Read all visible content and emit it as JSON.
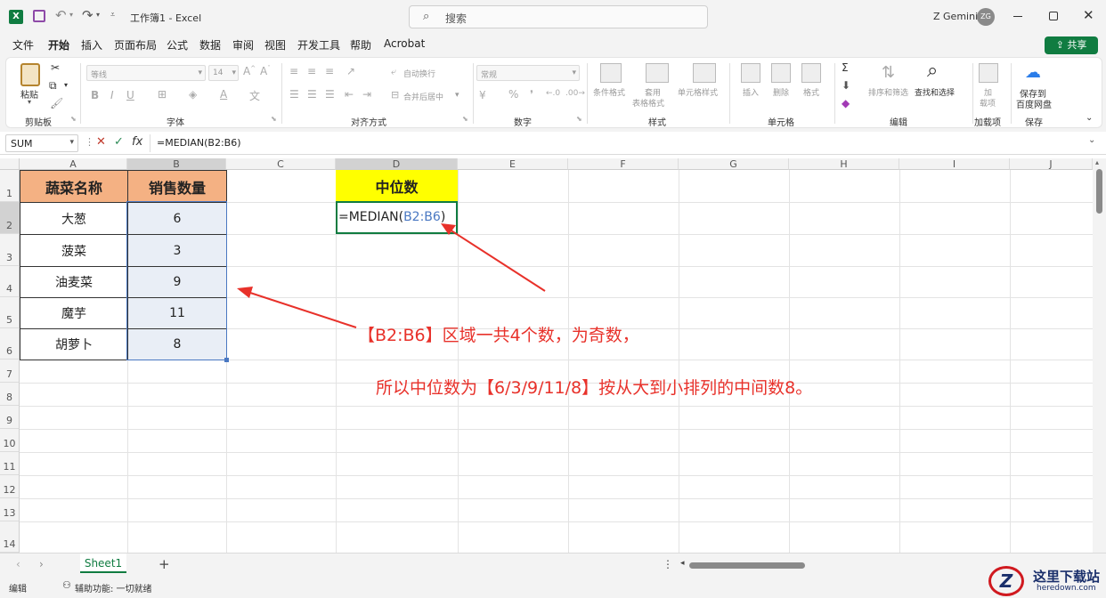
{
  "titlebar": {
    "autosave_icon": "excel-logo",
    "doc_title": "工作簿1",
    "separator": "-",
    "app_name": "Excel",
    "search_placeholder": "搜索",
    "user_name": "Z Gemini",
    "user_initials": "ZG"
  },
  "tabs": [
    "文件",
    "开始",
    "插入",
    "页面布局",
    "公式",
    "数据",
    "审阅",
    "视图",
    "开发工具",
    "帮助",
    "Acrobat"
  ],
  "share_label": "共享",
  "ribbon": {
    "paste": "粘贴",
    "font_name": "等线",
    "font_size": "14",
    "wrap_text": "自动换行",
    "merge_center": "合并后居中",
    "number_format": "常规",
    "cond_format": "条件格式",
    "table_format_1": "套用",
    "table_format_2": "表格格式",
    "cell_style": "单元格样式",
    "insert": "插入",
    "delete": "删除",
    "format": "格式",
    "sort_filter": "排序和筛选",
    "find_select": "查找和选择",
    "addin_1": "加",
    "addin_2": "载项",
    "save_baidu_1": "保存到",
    "save_baidu_2": "百度网盘",
    "groups": {
      "clipboard": "剪贴板",
      "font": "字体",
      "alignment": "对齐方式",
      "number": "数字",
      "styles": "样式",
      "cells": "单元格",
      "editing": "编辑",
      "addins": "加载项",
      "save": "保存"
    }
  },
  "formula_bar": {
    "name_box": "SUM",
    "formula": "=MEDIAN(B2:B6)"
  },
  "columns": [
    "A",
    "B",
    "C",
    "D",
    "E",
    "F",
    "G",
    "H",
    "I",
    "J"
  ],
  "rows": [
    "1",
    "2",
    "3",
    "4",
    "5",
    "6",
    "7",
    "8",
    "9",
    "10",
    "11",
    "12",
    "13",
    "14"
  ],
  "table": {
    "header_a": "蔬菜名称",
    "header_b": "销售数量",
    "items": [
      {
        "name": "大葱",
        "qty": "6"
      },
      {
        "name": "菠菜",
        "qty": "3"
      },
      {
        "name": "油麦菜",
        "qty": "9"
      },
      {
        "name": "魔芋",
        "qty": "11"
      },
      {
        "name": "胡萝卜",
        "qty": "8"
      }
    ]
  },
  "median": {
    "header": "中位数",
    "formula_prefix": "=MEDIAN(",
    "formula_range": "B2:B6",
    "formula_suffix": ")"
  },
  "annotation": {
    "line1": "【B2:B6】区域一共4个数，为奇数，",
    "line2": "所以中位数为【6/3/9/11/8】按从大到小排列的中间数8。"
  },
  "sheet_tab": "Sheet1",
  "status": {
    "mode": "编辑",
    "accessibility": "辅助功能: 一切就绪"
  },
  "watermark": {
    "brand": "这里下载站",
    "url": "heredown.com"
  },
  "colors": {
    "excel_green": "#107c41",
    "header_orange": "#f4b183",
    "median_yellow": "#ffff00",
    "annotation_red": "#e8312a"
  }
}
